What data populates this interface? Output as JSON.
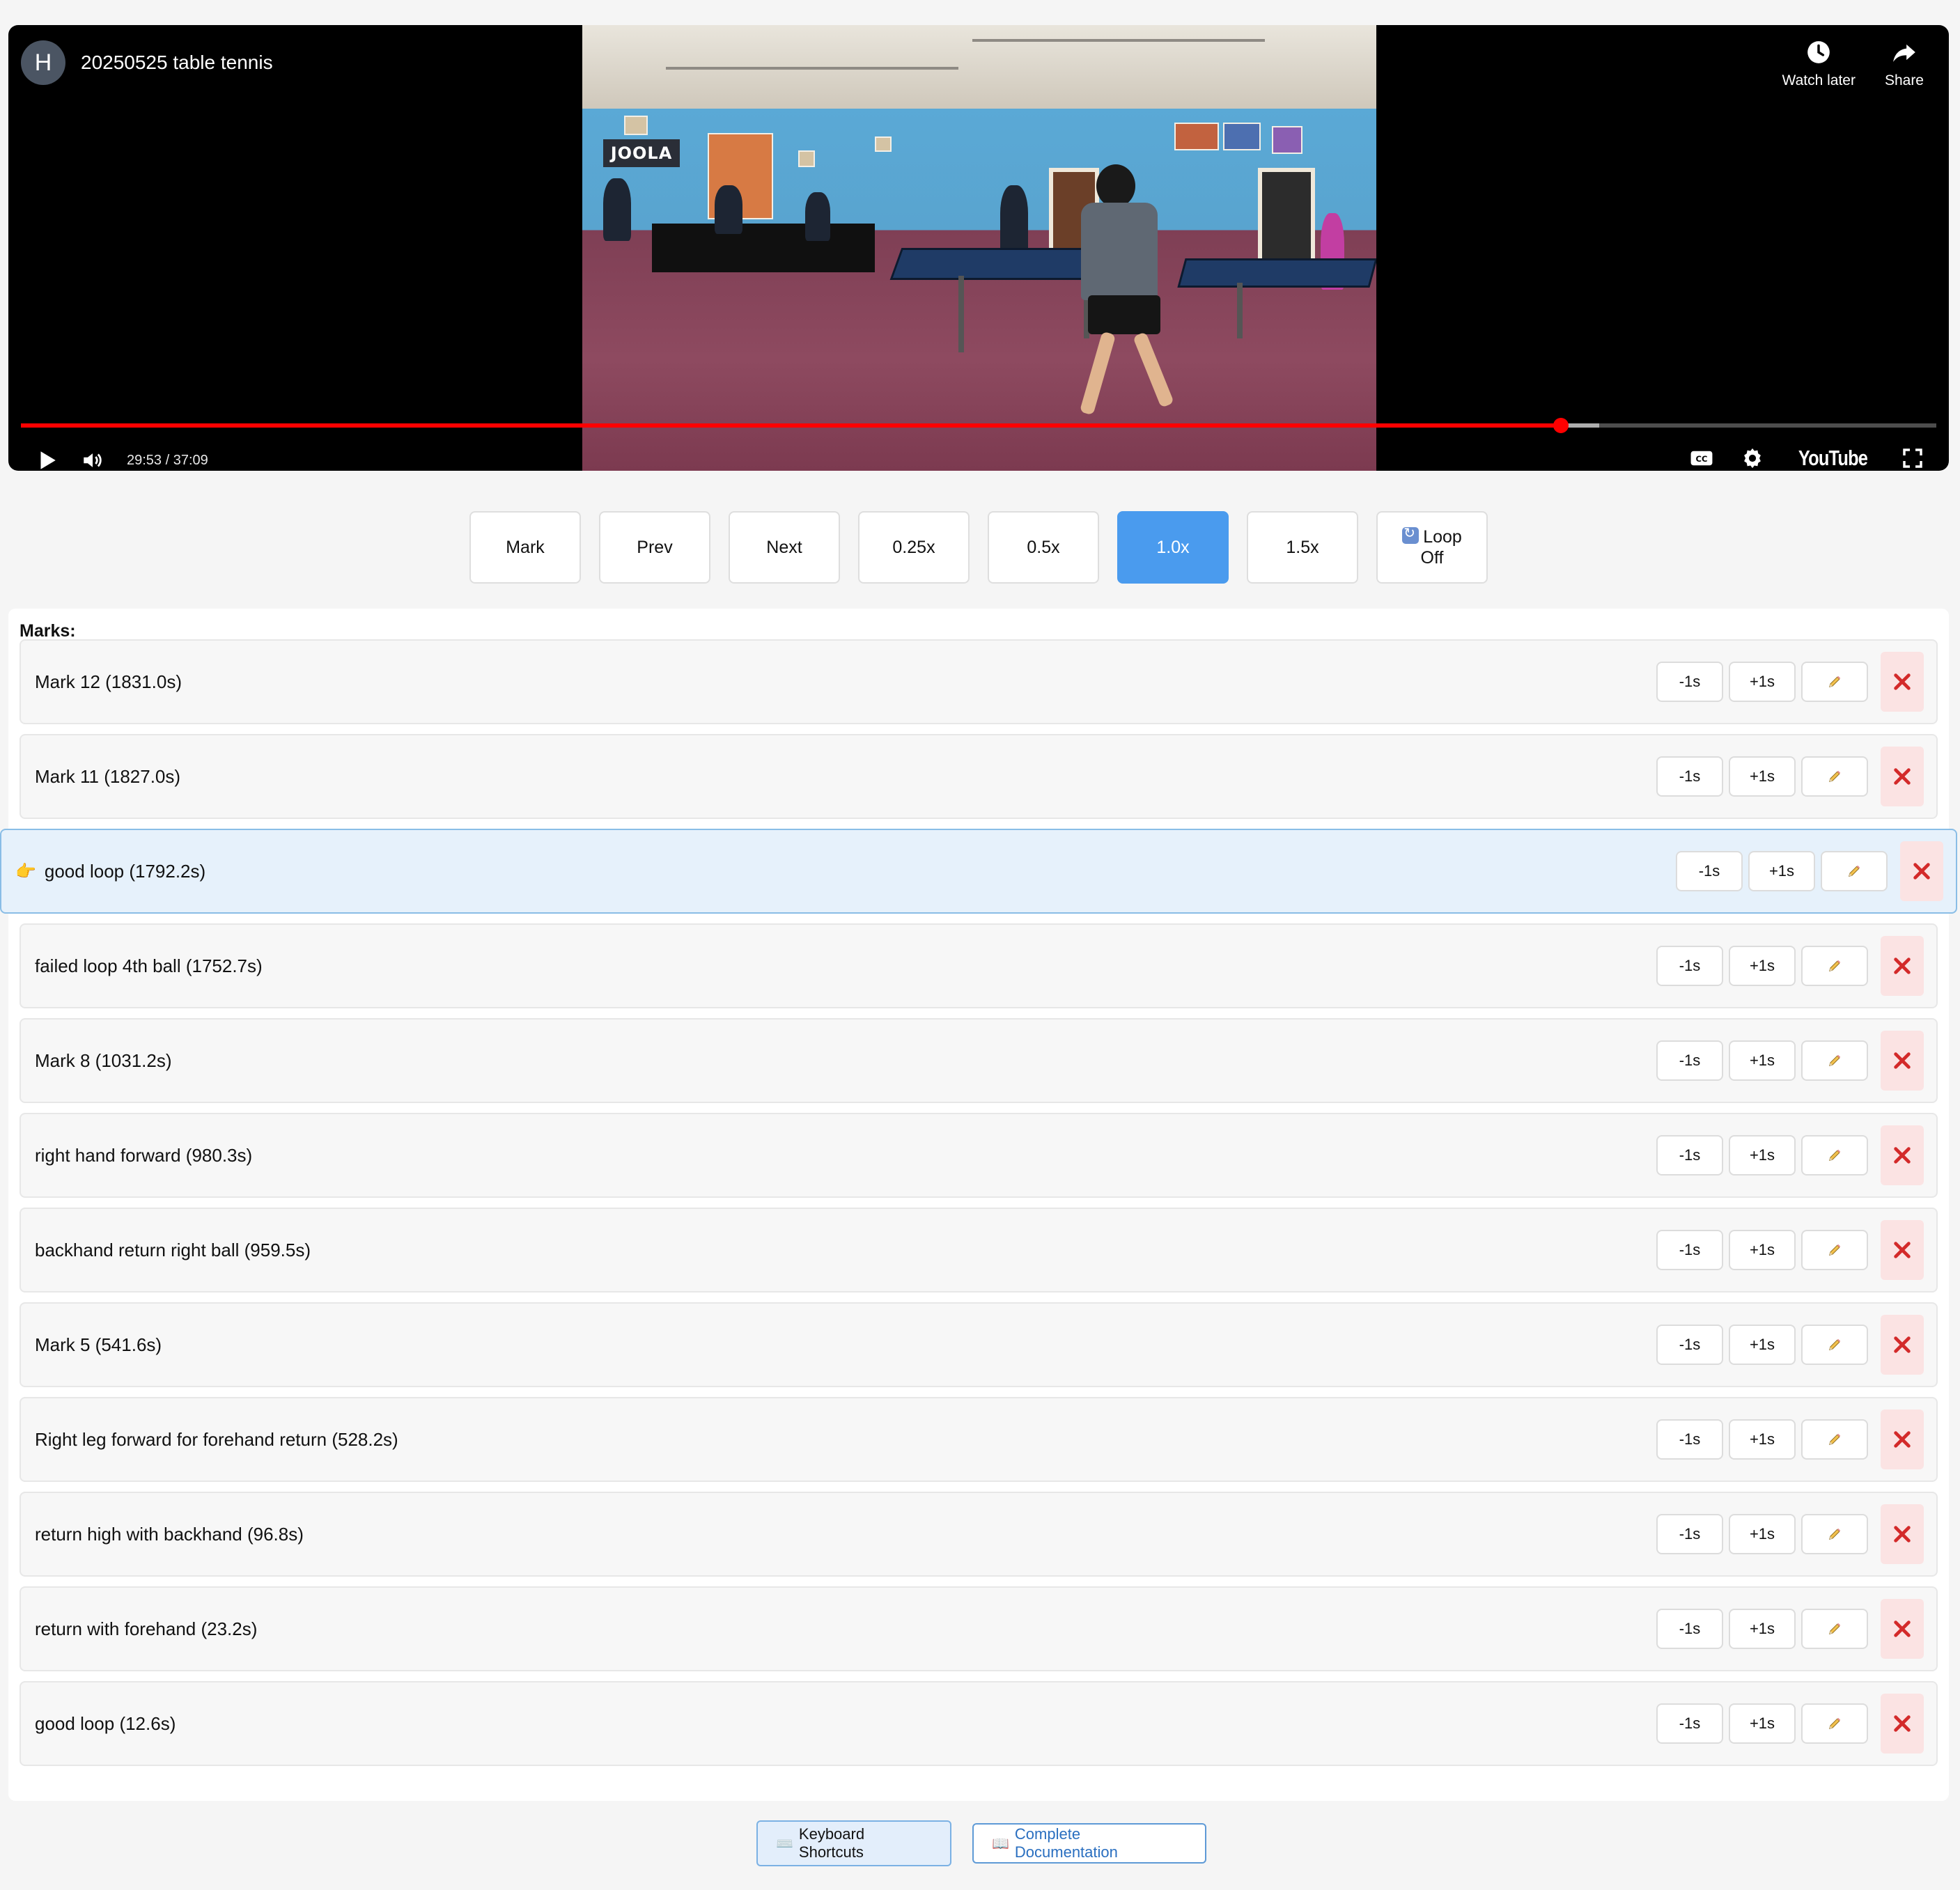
{
  "video": {
    "channel_initial": "H",
    "title": "20250525 table tennis",
    "watch_later_label": "Watch later",
    "share_label": "Share",
    "time_display": "29:53 / 37:09",
    "progress_fraction": 0.804,
    "buffered_fraction": 0.824,
    "brand": "YouTube",
    "icons": [
      "play-icon",
      "volume-icon",
      "captions-icon",
      "settings-icon",
      "fullscreen-icon",
      "clock-icon",
      "share-icon"
    ],
    "accent_color": "#ff0000"
  },
  "controls": [
    {
      "label": "Mark",
      "active": false
    },
    {
      "label": "Prev",
      "active": false
    },
    {
      "label": "Next",
      "active": false
    },
    {
      "label": "0.25x",
      "active": false
    },
    {
      "label": "0.5x",
      "active": false
    },
    {
      "label": "1.0x",
      "active": true
    },
    {
      "label": "1.5x",
      "active": false
    }
  ],
  "loop": {
    "line1": "Loop",
    "line2": "Off"
  },
  "active_color": "#4a9bee",
  "marks": {
    "heading": "Marks:",
    "minus_label": "-1s",
    "plus_label": "+1s",
    "current_indicator": "👉",
    "items": [
      {
        "label": "Mark 12 (1831.0s)",
        "current": false
      },
      {
        "label": "Mark 11 (1827.0s)",
        "current": false
      },
      {
        "label": "good loop (1792.2s)",
        "current": true
      },
      {
        "label": "failed loop 4th ball (1752.7s)",
        "current": false
      },
      {
        "label": "Mark 8 (1031.2s)",
        "current": false
      },
      {
        "label": "right hand forward (980.3s)",
        "current": false
      },
      {
        "label": "backhand return right ball (959.5s)",
        "current": false
      },
      {
        "label": "Mark 5 (541.6s)",
        "current": false
      },
      {
        "label": "Right leg forward for forehand return (528.2s)",
        "current": false
      },
      {
        "label": "return high with backhand (96.8s)",
        "current": false
      },
      {
        "label": "return with forehand (23.2s)",
        "current": false
      },
      {
        "label": "good loop (12.6s)",
        "current": false
      }
    ]
  },
  "footer": {
    "keyboard_icon": "⌨️",
    "keyboard_label": "Keyboard Shortcuts",
    "docs_icon": "📖",
    "docs_label": "Complete Documentation"
  }
}
